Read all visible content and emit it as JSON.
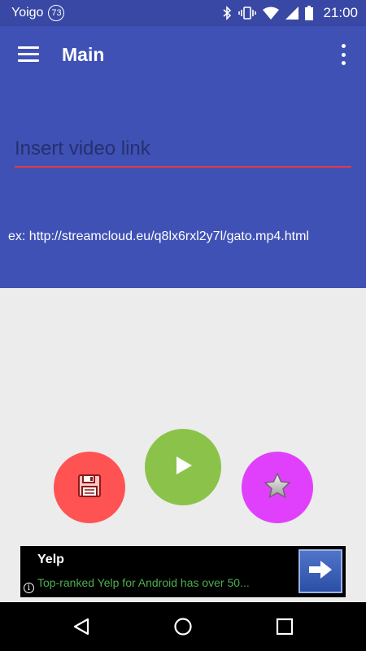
{
  "status_bar": {
    "carrier": "Yoigo",
    "notification_count": "73",
    "time": "21:00",
    "icons": [
      "bluetooth-icon",
      "vibrate-icon",
      "wifi-icon",
      "signal-icon",
      "battery-icon"
    ]
  },
  "app_bar": {
    "title": "Main",
    "menu_icon": "hamburger-menu-icon",
    "overflow_icon": "more-vert-icon"
  },
  "main": {
    "video_link_placeholder": "Insert video link",
    "video_link_value": "",
    "example_text": "ex: http://streamcloud.eu/q8lx6rxl2y7l/gato.mp4.html"
  },
  "actions": {
    "save_icon": "floppy-disk-icon",
    "play_icon": "play-icon",
    "favorite_icon": "star-icon"
  },
  "ad": {
    "title": "Yelp",
    "description": "Top-ranked Yelp for Android has over 50...",
    "info_icon": "i"
  },
  "colors": {
    "primary": "#3f51b5",
    "status_bar": "#3948a4",
    "save": "#ff5252",
    "play": "#8bc34a",
    "favorite": "#e040fb",
    "input_underline": "#e53945"
  }
}
